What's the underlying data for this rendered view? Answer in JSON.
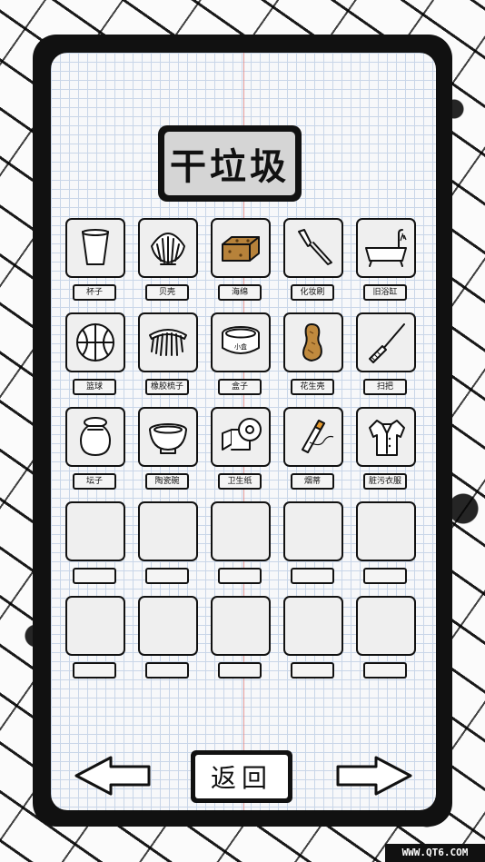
{
  "title": "干垃圾",
  "items": [
    {
      "label": "杯子",
      "icon": "cup-icon"
    },
    {
      "label": "贝壳",
      "icon": "shell-icon"
    },
    {
      "label": "海绵",
      "icon": "sponge-icon"
    },
    {
      "label": "化妆刷",
      "icon": "makeup-brush-icon"
    },
    {
      "label": "旧浴缸",
      "icon": "bathtub-icon"
    },
    {
      "label": "篮球",
      "icon": "basketball-icon"
    },
    {
      "label": "橡胶梳子",
      "icon": "comb-icon"
    },
    {
      "label": "盒子",
      "icon": "box-icon"
    },
    {
      "label": "花生壳",
      "icon": "peanut-icon"
    },
    {
      "label": "扫把",
      "icon": "broom-icon"
    },
    {
      "label": "坛子",
      "icon": "jar-icon"
    },
    {
      "label": "陶瓷碗",
      "icon": "bowl-icon"
    },
    {
      "label": "卫生纸",
      "icon": "toilet-paper-icon"
    },
    {
      "label": "烟蒂",
      "icon": "cigarette-icon"
    },
    {
      "label": "脏污衣服",
      "icon": "shirt-icon"
    },
    {
      "label": "",
      "icon": ""
    },
    {
      "label": "",
      "icon": ""
    },
    {
      "label": "",
      "icon": ""
    },
    {
      "label": "",
      "icon": ""
    },
    {
      "label": "",
      "icon": ""
    },
    {
      "label": "",
      "icon": ""
    },
    {
      "label": "",
      "icon": ""
    },
    {
      "label": "",
      "icon": ""
    },
    {
      "label": "",
      "icon": ""
    },
    {
      "label": "",
      "icon": ""
    }
  ],
  "box_text": "小盒",
  "nav": {
    "back_label": "返回",
    "prev_icon": "left-arrow-icon",
    "next_icon": "right-arrow-icon"
  },
  "watermark": "WWW.QT6.COM"
}
